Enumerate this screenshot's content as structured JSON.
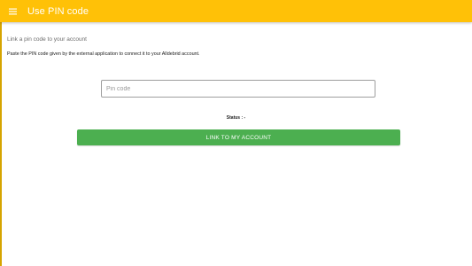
{
  "app": {
    "title": "Use PIN code",
    "accent_color": "#ffc107",
    "menu_icon": "hamburger-menu-icon"
  },
  "content": {
    "section_title": "Link a pin code to your account",
    "description": "Paste the PIN code given by the external application to connect it to your Alldebrid account.",
    "pin_input": {
      "placeholder": "Pin code",
      "value": ""
    },
    "status_label": "Status : -",
    "link_button": {
      "label": "LINK TO MY ACCOUNT",
      "color": "#4caf50"
    }
  }
}
